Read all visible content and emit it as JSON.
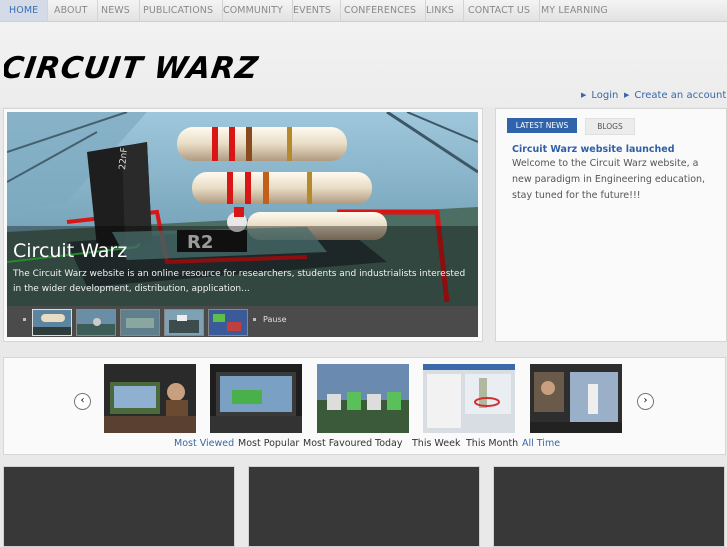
{
  "nav": {
    "items": [
      "HOME",
      "ABOUT",
      "NEWS",
      "PUBLICATIONS",
      "COMMUNITY",
      "EVENTS",
      "CONFERENCES",
      "LINKS",
      "CONTACT US",
      "MY LEARNING"
    ]
  },
  "header": {
    "logo_text": "CIRCUIT WARZ",
    "login": "Login",
    "create_account": "Create an account"
  },
  "slideshow": {
    "title": "Circuit Warz",
    "description": "The Circuit Warz website is an online resource for researchers, students and industrialists interested in the wider development, distribution, application...",
    "pause": "Pause"
  },
  "news": {
    "tabs": [
      "LATEST NEWS",
      "BLOGS"
    ],
    "headline": "Circuit Warz website launched",
    "body": "Welcome to the Circuit Warz website, a new paradigm in Engineering education, stay tuned for the future!!!"
  },
  "videos": {
    "filters": [
      "Most Viewed",
      "Most Popular",
      "Most Favoured",
      "Today",
      "This Week",
      "This Month",
      "All Time"
    ]
  },
  "colors": {
    "link_blue": "#3a66a8",
    "tab_active": "#2f64ac"
  }
}
